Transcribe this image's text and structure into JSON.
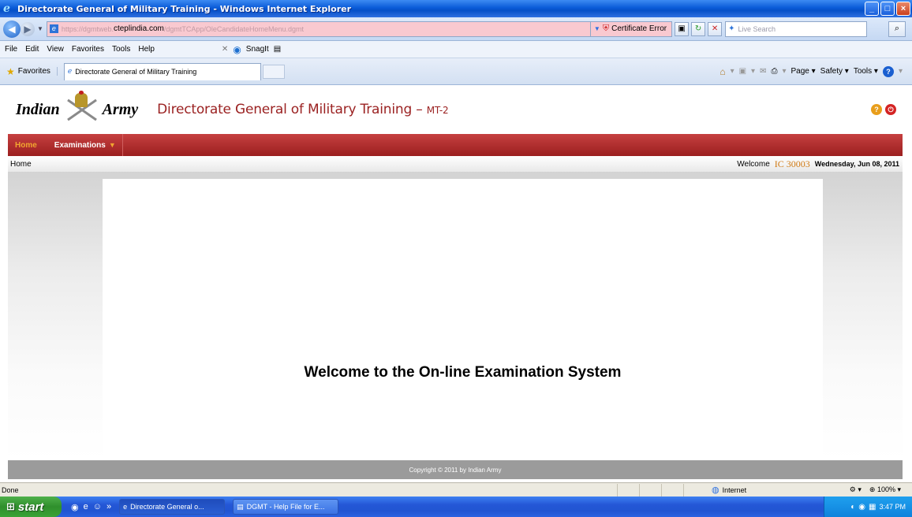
{
  "window": {
    "title": "Directorate General of Military Training - Windows Internet Explorer",
    "controls": {
      "minimize": "_",
      "maximize": "□",
      "close": "×"
    }
  },
  "addressbar": {
    "url_prefix": "https://dgmtweb.",
    "url_domain": "cteplindia.com",
    "url_path": "/dgmtTCApp/OleCandidateHomeMenu.dgmt",
    "certificate_label": "Certificate Error",
    "search_placeholder": "Live Search"
  },
  "menubar": {
    "items": [
      "File",
      "Edit",
      "View",
      "Favorites",
      "Tools",
      "Help"
    ],
    "snagit_label": "SnagIt"
  },
  "favbar": {
    "favorites_label": "Favorites",
    "tab_title": "Directorate General of Military Training",
    "commands": [
      "Page ▾",
      "Safety ▾",
      "Tools ▾"
    ]
  },
  "site": {
    "logo_left": "Indian",
    "logo_right": "Army",
    "title": "Directorate General of Military Training – ",
    "title_suffix": "MT-2",
    "nav": {
      "home": "Home",
      "examinations": "Examinations"
    },
    "breadcrumb": "Home",
    "welcome_prefix": "Welcome",
    "user_id": "IC 30003",
    "date": "Wednesday, Jun 08, 2011",
    "welcome_message": "Welcome to the On-line Examination System",
    "copyright": "Copyright © 2011 by Indian Army"
  },
  "statusbar": {
    "status": "Done",
    "zone": "Internet",
    "zoom": "100%"
  },
  "taskbar": {
    "start_label": "start",
    "tasks": [
      "Directorate General o...",
      "DGMT - Help File for E..."
    ],
    "clock": "3:47 PM"
  },
  "colors": {
    "nav_red": "#9b1f1f",
    "title_red": "#9b2222",
    "home_orange": "#f2a630",
    "user_orange": "#d07a14",
    "footer_gray": "#9b9b9b"
  }
}
